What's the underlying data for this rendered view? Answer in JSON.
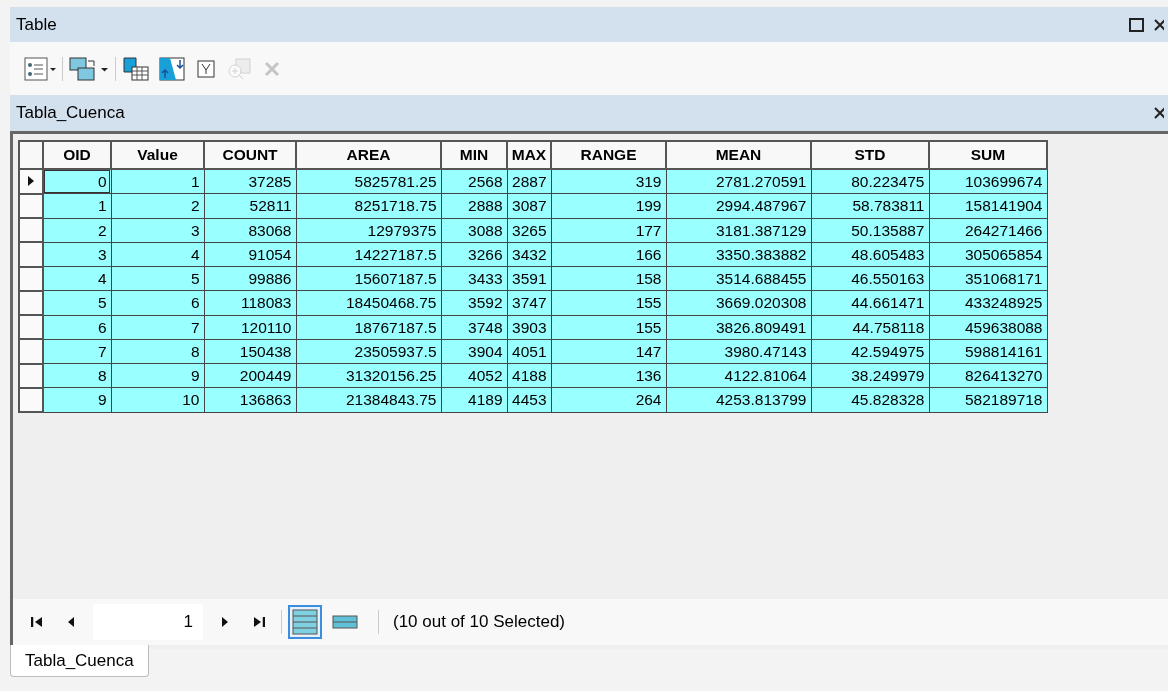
{
  "window": {
    "title": "Table"
  },
  "table_title": "Tabla_Cuenca",
  "table": {
    "columns": [
      "OID",
      "Value",
      "COUNT",
      "AREA",
      "MIN",
      "MAX",
      "RANGE",
      "MEAN",
      "STD",
      "SUM"
    ],
    "rows": [
      {
        "selected": true,
        "current": true,
        "cells": [
          "0",
          "1",
          "37285",
          "5825781.25",
          "2568",
          "2887",
          "319",
          "2781.270591",
          "80.223475",
          "103699674"
        ]
      },
      {
        "selected": true,
        "current": false,
        "cells": [
          "1",
          "2",
          "52811",
          "8251718.75",
          "2888",
          "3087",
          "199",
          "2994.487967",
          "58.783811",
          "158141904"
        ]
      },
      {
        "selected": true,
        "current": false,
        "cells": [
          "2",
          "3",
          "83068",
          "12979375",
          "3088",
          "3265",
          "177",
          "3181.387129",
          "50.135887",
          "264271466"
        ]
      },
      {
        "selected": true,
        "current": false,
        "cells": [
          "3",
          "4",
          "91054",
          "14227187.5",
          "3266",
          "3432",
          "166",
          "3350.383882",
          "48.605483",
          "305065854"
        ]
      },
      {
        "selected": true,
        "current": false,
        "cells": [
          "4",
          "5",
          "99886",
          "15607187.5",
          "3433",
          "3591",
          "158",
          "3514.688455",
          "46.550163",
          "351068171"
        ]
      },
      {
        "selected": true,
        "current": false,
        "cells": [
          "5",
          "6",
          "118083",
          "18450468.75",
          "3592",
          "3747",
          "155",
          "3669.020308",
          "44.661471",
          "433248925"
        ]
      },
      {
        "selected": true,
        "current": false,
        "cells": [
          "6",
          "7",
          "120110",
          "18767187.5",
          "3748",
          "3903",
          "155",
          "3826.809491",
          "44.758118",
          "459638088"
        ]
      },
      {
        "selected": true,
        "current": false,
        "cells": [
          "7",
          "8",
          "150438",
          "23505937.5",
          "3904",
          "4051",
          "147",
          "3980.47143",
          "42.594975",
          "598814161"
        ]
      },
      {
        "selected": true,
        "current": false,
        "cells": [
          "8",
          "9",
          "200449",
          "31320156.25",
          "4052",
          "4188",
          "136",
          "4122.81064",
          "38.249979",
          "826413270"
        ]
      },
      {
        "selected": true,
        "current": false,
        "cells": [
          "9",
          "10",
          "136863",
          "21384843.75",
          "4189",
          "4453",
          "264",
          "4253.813799",
          "45.828328",
          "582189718"
        ]
      }
    ]
  },
  "navigator": {
    "record": "1",
    "views": [
      {
        "selected": true
      },
      {
        "selected": false
      }
    ],
    "status": "(10 out of 10 Selected)"
  },
  "tabs": [
    {
      "label": "Tabla_Cuenca",
      "selected": true
    }
  ]
}
